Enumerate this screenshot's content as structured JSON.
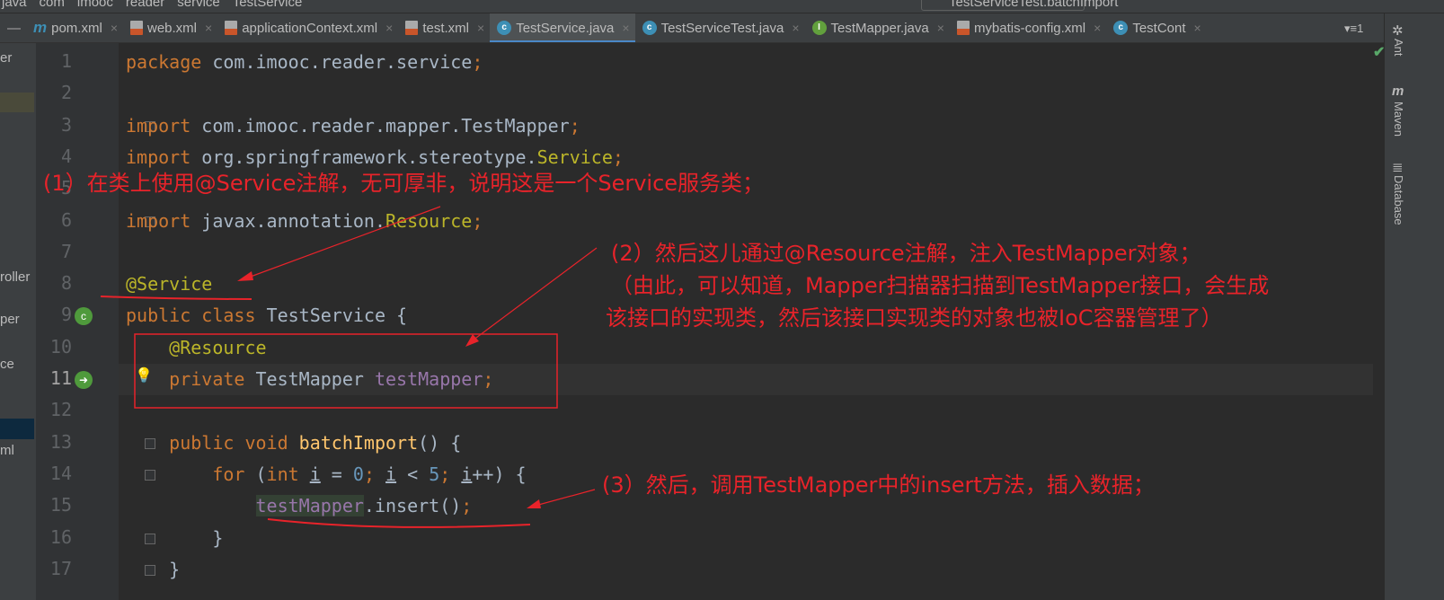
{
  "breadcrumb": [
    "java",
    "com",
    "imooc",
    "reader",
    "service",
    "TestService"
  ],
  "run_config": "TestServiceTest.batchImport",
  "tabs": [
    {
      "label": "pom.xml",
      "icon": "maven-icon",
      "active": false
    },
    {
      "label": "web.xml",
      "icon": "xml-icon",
      "active": false
    },
    {
      "label": "applicationContext.xml",
      "icon": "xml-icon",
      "active": false
    },
    {
      "label": "test.xml",
      "icon": "xml-icon",
      "active": false
    },
    {
      "label": "TestService.java",
      "icon": "class-icon",
      "active": true
    },
    {
      "label": "TestServiceTest.java",
      "icon": "class-icon",
      "active": false
    },
    {
      "label": "TestMapper.java",
      "icon": "interface-icon",
      "active": false
    },
    {
      "label": "mybatis-config.xml",
      "icon": "xml-icon",
      "active": false
    },
    {
      "label": "TestCont",
      "icon": "class-icon",
      "active": false
    }
  ],
  "tab_overflow": "1",
  "project_panel": [
    "er",
    "roller",
    "per",
    "ce",
    "ml"
  ],
  "right_tools": [
    "Ant",
    "Maven",
    "Database"
  ],
  "current_line": 11,
  "code": [
    [
      [
        "package ",
        "kw"
      ],
      [
        "com.imooc.reader.service",
        ""
      ],
      [
        ";",
        "kw"
      ]
    ],
    [],
    [
      [
        "import ",
        "kw"
      ],
      [
        "com.imooc.reader.mapper.TestMapper",
        ""
      ],
      [
        ";",
        "kw"
      ]
    ],
    [
      [
        "import ",
        "kw"
      ],
      [
        "org.springframework.stereotype.",
        ""
      ],
      [
        "Service",
        "an"
      ],
      [
        ";",
        "kw"
      ]
    ],
    [],
    [
      [
        "import ",
        "kw"
      ],
      [
        "javax.annotation.",
        ""
      ],
      [
        "Resource",
        "an"
      ],
      [
        ";",
        "kw"
      ]
    ],
    [],
    [
      [
        "@Service",
        "an"
      ]
    ],
    [
      [
        "public class ",
        "kw"
      ],
      [
        "TestService {",
        ""
      ]
    ],
    [
      [
        "    @Resource",
        "an"
      ]
    ],
    [
      [
        "    private ",
        "kw"
      ],
      [
        "TestMapper ",
        ""
      ],
      [
        "testMapper",
        "fld"
      ],
      [
        ";",
        "kw"
      ]
    ],
    [],
    [
      [
        "    public void ",
        "kw"
      ],
      [
        "batchImport",
        "fn"
      ],
      [
        "() {",
        ""
      ]
    ],
    [
      [
        "        for ",
        "kw"
      ],
      [
        "(",
        ""
      ],
      [
        "int ",
        "kw"
      ],
      [
        "i",
        "lv"
      ],
      [
        " = ",
        ""
      ],
      [
        "0",
        "num"
      ],
      [
        "; ",
        "kw"
      ],
      [
        "i",
        "lv"
      ],
      [
        " < ",
        ""
      ],
      [
        "5",
        "num"
      ],
      [
        "; ",
        "kw"
      ],
      [
        "i",
        "lv"
      ],
      [
        "++) {",
        ""
      ]
    ],
    [
      [
        "            ",
        ""
      ],
      [
        "testMapper",
        "fieldref"
      ],
      [
        ".insert()",
        ""
      ],
      [
        ";",
        "kw"
      ]
    ],
    [
      [
        "        }",
        ""
      ]
    ],
    [
      [
        "    }",
        ""
      ]
    ]
  ],
  "annotations": {
    "note1": "(1）在类上使用@Service注解，无可厚非，说明这是一个Service服务类；",
    "note2_line1": "(2）然后这儿通过@Resource注解，注入TestMapper对象；",
    "note2_line2": "（由此，可以知道，Mapper扫描器扫描到TestMapper接口，会生成",
    "note2_line3": "该接口的实现类，然后该接口实现类的对象也被IoC容器管理了）",
    "note3": "(3）然后，调用TestMapper中的insert方法，插入数据；"
  },
  "colors": {
    "annotation_red": "#e8232a",
    "background": "#2b2b2b",
    "keyword": "#cc7832"
  }
}
